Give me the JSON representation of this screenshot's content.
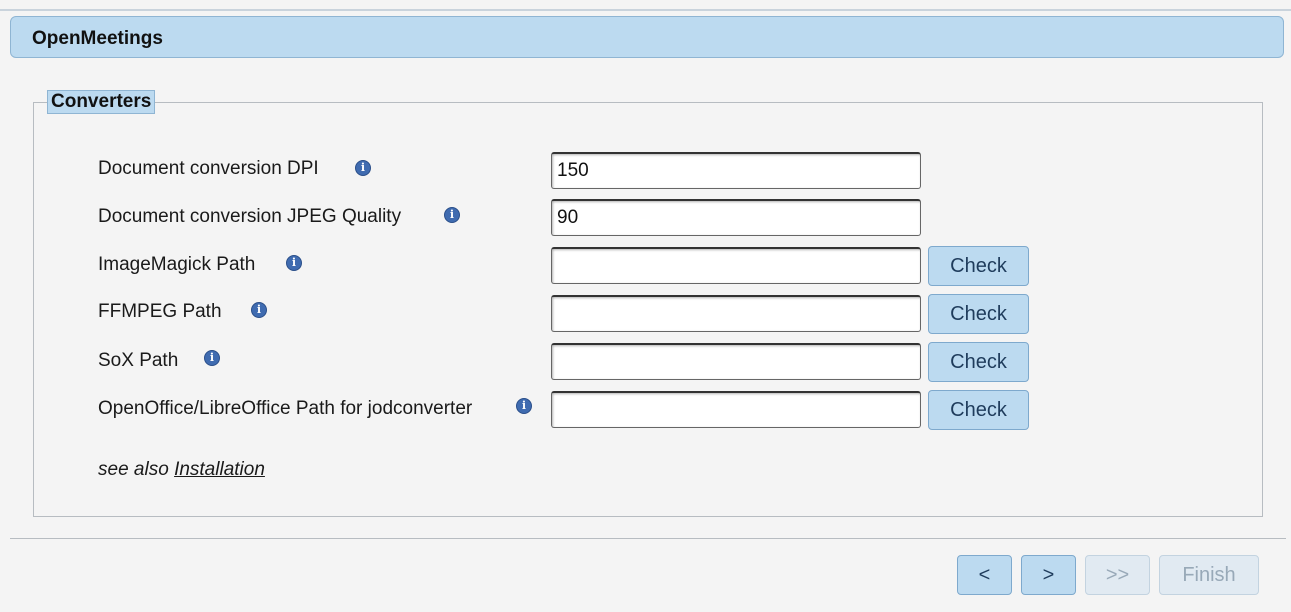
{
  "header": {
    "title": "OpenMeetings"
  },
  "section": {
    "legend": "Converters"
  },
  "fields": [
    {
      "label": "Document conversion DPI",
      "value": "150",
      "has_check": false
    },
    {
      "label": "Document conversion JPEG Quality",
      "value": "90",
      "has_check": false
    },
    {
      "label": "ImageMagick Path",
      "value": "",
      "has_check": true
    },
    {
      "label": "FFMPEG Path",
      "value": "",
      "has_check": true
    },
    {
      "label": "SoX Path",
      "value": "",
      "has_check": true
    },
    {
      "label": "OpenOffice/LibreOffice Path for jodconverter",
      "value": "",
      "has_check": true
    }
  ],
  "check_label": "Check",
  "see_also": {
    "prefix": "see also",
    "link": "Installation"
  },
  "nav": {
    "prev": "<",
    "next": ">",
    "last": ">>",
    "finish": "Finish"
  },
  "icons": {
    "info": "info-icon"
  },
  "colors": {
    "accent": "#bcdaf0",
    "border": "#8fb5d3",
    "info": "#3f6bb0"
  }
}
